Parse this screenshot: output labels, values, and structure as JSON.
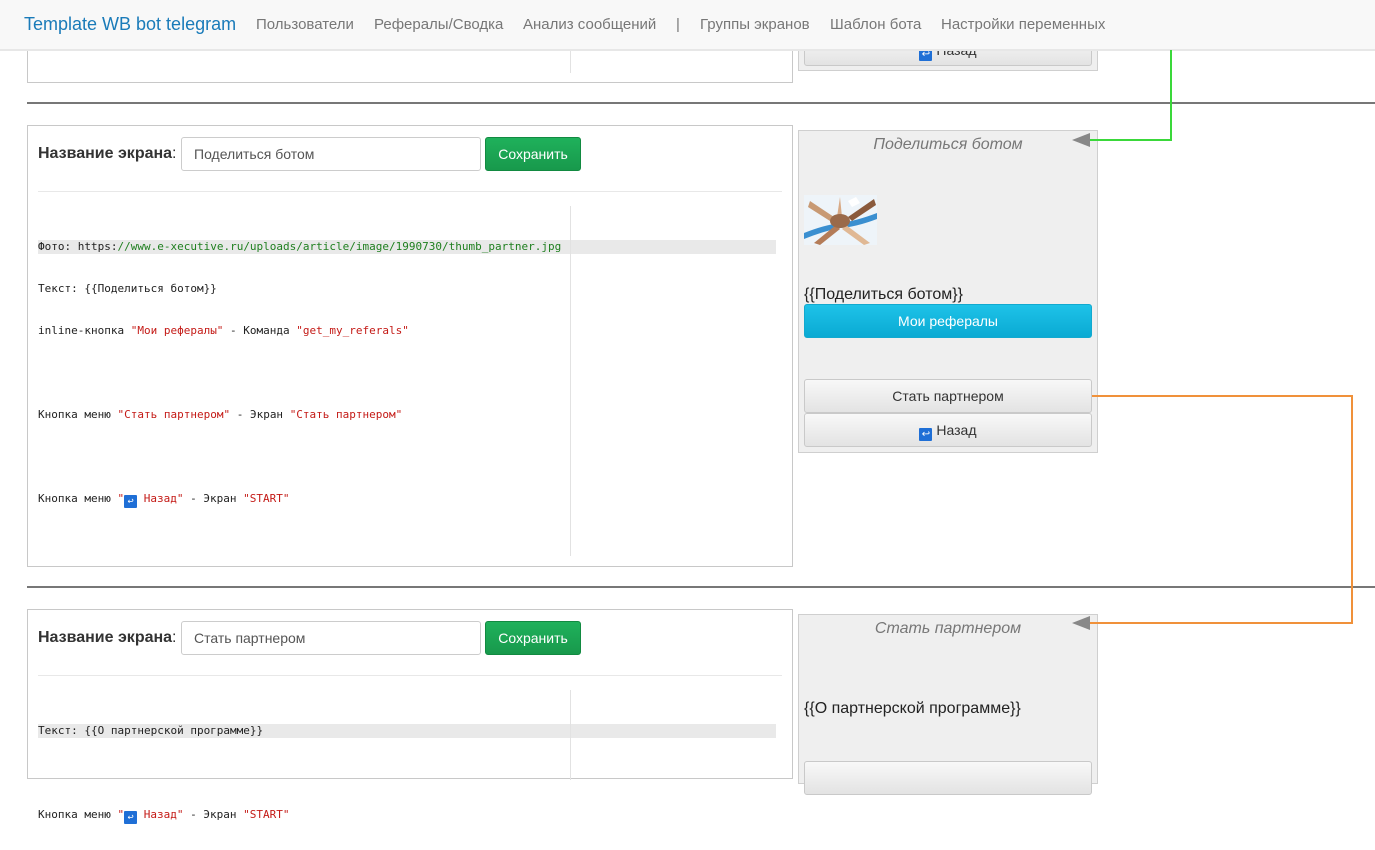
{
  "navbar": {
    "brand": "Template WB bot telegram",
    "items": [
      "Пользователи",
      "Рефералы/Сводка",
      "Анализ сообщений",
      "|",
      "Группы экранов",
      "Шаблон бота",
      "Настройки переменных"
    ]
  },
  "common": {
    "name_label": "Название экрана",
    "colon": ":",
    "save_label": "Сохранить",
    "back_label": "Назад"
  },
  "screen1": {
    "name_value": "Поделиться ботом",
    "preview": {
      "title": "Поделиться ботом",
      "text": "{{Поделиться ботом}}",
      "inline_button": "Мои рефералы",
      "menu_button": "Стать партнером"
    },
    "code": {
      "photo_prefix": "Фото: https:",
      "photo_url": "//www.e-xecutive.ru/uploads/article/image/1990730/thumb_partner.jpg",
      "text_line": "Текст: {{Поделиться ботом}}",
      "inline_prefix": "inline-кнопка ",
      "inline_name": "\"Мои рефералы\"",
      "inline_mid": " - Команда ",
      "inline_cmd": "\"get_my_referals\"",
      "menu1_prefix": "Кнопка меню ",
      "menu1_name": "\"Стать партнером\"",
      "menu1_mid": " - Экран ",
      "menu1_target": "\"Стать партнером\"",
      "menu2_prefix": "Кнопка меню ",
      "menu2_quote": "\"",
      "menu2_name": " Назад\"",
      "menu2_mid": " - Экран ",
      "menu2_target": "\"START\""
    }
  },
  "screen2": {
    "name_value": "Стать партнером",
    "preview": {
      "title": "Стать партнером",
      "text": "{{О партнерской программе}}"
    },
    "code": {
      "text_line": "Текст: {{О партнерской программе}}",
      "menu_prefix": "Кнопка меню ",
      "menu_quote": "\"",
      "menu_name": " Назад\"",
      "menu_mid": " - Экран ",
      "menu_target": "\"START\""
    }
  },
  "icons": {
    "back": "↩"
  },
  "colors": {
    "brand": "#1a7bb9",
    "save": "#1fb15b",
    "inline_button": "#1ec2e8",
    "arrow_green": "#3ad83a",
    "arrow_orange": "#f0913a"
  }
}
